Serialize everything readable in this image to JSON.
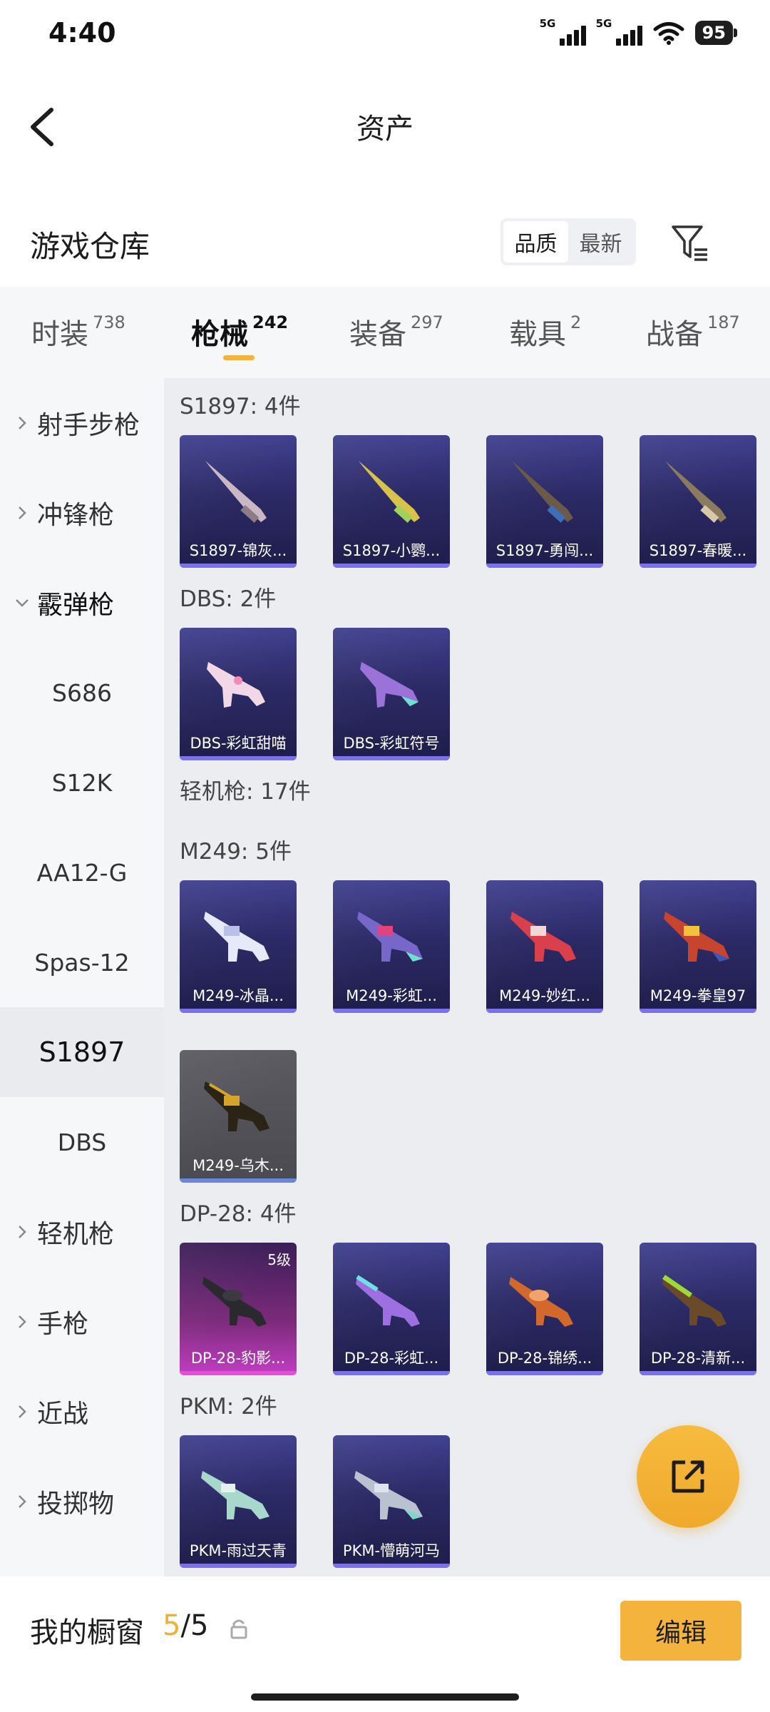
{
  "status_bar": {
    "time": "4:40",
    "signal1": "5G",
    "signal2": "5G",
    "battery": "95"
  },
  "header": {
    "title": "资产"
  },
  "section": {
    "title": "游戏仓库",
    "sort_options": [
      "品质",
      "最新"
    ],
    "active_sort": "品质"
  },
  "tabs": [
    {
      "label": "时装",
      "count": "738"
    },
    {
      "label": "枪械",
      "count": "242"
    },
    {
      "label": "装备",
      "count": "297"
    },
    {
      "label": "载具",
      "count": "2"
    },
    {
      "label": "战备",
      "count": "187"
    }
  ],
  "active_tab": "枪械",
  "sidebar": {
    "items": [
      {
        "label": "射手步枪",
        "type": "category"
      },
      {
        "label": "冲锋枪",
        "type": "category"
      },
      {
        "label": "霰弹枪",
        "type": "category-expanded"
      },
      {
        "label": "S686",
        "type": "sub"
      },
      {
        "label": "S12K",
        "type": "sub"
      },
      {
        "label": "AA12-G",
        "type": "sub"
      },
      {
        "label": "Spas-12",
        "type": "sub"
      },
      {
        "label": "S1897",
        "type": "sub-selected"
      },
      {
        "label": "DBS",
        "type": "sub"
      },
      {
        "label": "轻机枪",
        "type": "category"
      },
      {
        "label": "手枪",
        "type": "category"
      },
      {
        "label": "近战",
        "type": "category"
      },
      {
        "label": "投掷物",
        "type": "category"
      }
    ]
  },
  "groups": [
    {
      "title": "S1897: 4件",
      "items": [
        "S1897-锦灰...",
        "S1897-小鹦...",
        "S1897-勇闯...",
        "S1897-春暖..."
      ]
    },
    {
      "title": "DBS: 2件",
      "items": [
        "DBS-彩虹甜喵",
        "DBS-彩虹符号"
      ]
    },
    {
      "title": "轻机枪: 17件",
      "items": []
    },
    {
      "title": "M249: 5件",
      "items": [
        "M249-冰晶...",
        "M249-彩虹...",
        "M249-妙红...",
        "M249-拳皇97",
        "M249-乌木..."
      ]
    },
    {
      "title": "DP-28: 4件",
      "items": [
        "DP-28-豹影...",
        "DP-28-彩虹...",
        "DP-28-锦绣...",
        "DP-28-清新..."
      ],
      "badge": "5级"
    },
    {
      "title": "PKM: 2件",
      "items": [
        "PKM-雨过天青",
        "PKM-懵萌河马"
      ]
    }
  ],
  "bottom": {
    "showcase_label": "我的橱窗",
    "current": "5",
    "separator": "/",
    "total": "5",
    "edit_label": "编辑"
  },
  "colors": {
    "accent": "#f3b33d",
    "card_purple": "#2c2a66",
    "card_bar": "#7b71ea",
    "pink": "#c23ec3"
  },
  "icons": {
    "back": "chevron-left-icon",
    "filter": "filter-icon",
    "share": "external-link-icon",
    "lock": "lock-icon"
  }
}
